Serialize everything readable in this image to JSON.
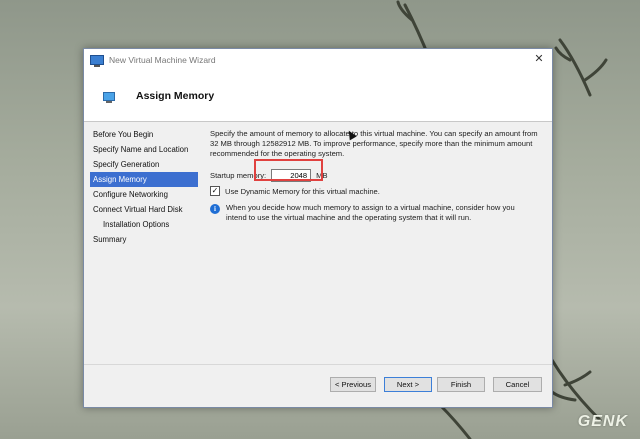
{
  "window": {
    "title": "New Virtual Machine Wizard",
    "close_glyph": "✕"
  },
  "header": {
    "title": "Assign Memory"
  },
  "nav": {
    "items": [
      {
        "label": "Before You Begin",
        "active": false,
        "sub": false
      },
      {
        "label": "Specify Name and Location",
        "active": false,
        "sub": false
      },
      {
        "label": "Specify Generation",
        "active": false,
        "sub": false
      },
      {
        "label": "Assign Memory",
        "active": true,
        "sub": false
      },
      {
        "label": "Configure Networking",
        "active": false,
        "sub": false
      },
      {
        "label": "Connect Virtual Hard Disk",
        "active": false,
        "sub": false
      },
      {
        "label": "Installation Options",
        "active": false,
        "sub": true
      },
      {
        "label": "Summary",
        "active": false,
        "sub": false
      }
    ]
  },
  "content": {
    "description": "Specify the amount of memory to allocate to this virtual machine. You can specify an amount from 32 MB through 12582912 MB. To improve performance, specify more than the minimum amount recommended for the operating system.",
    "startup_memory_label": "Startup memory:",
    "startup_memory_value": "2048",
    "startup_memory_unit": "MB",
    "dynamic_memory_label": "Use Dynamic Memory for this virtual machine.",
    "dynamic_memory_checked": true,
    "info_text": "When you decide how much memory to assign to a virtual machine, consider how you intend to use the virtual machine and the operating system that it will run."
  },
  "buttons": {
    "previous": "< Previous",
    "next": "Next >",
    "finish": "Finish",
    "cancel": "Cancel"
  },
  "watermark": "GENK",
  "colors": {
    "accent": "#3c6fd0",
    "highlight": "#e0413f"
  }
}
